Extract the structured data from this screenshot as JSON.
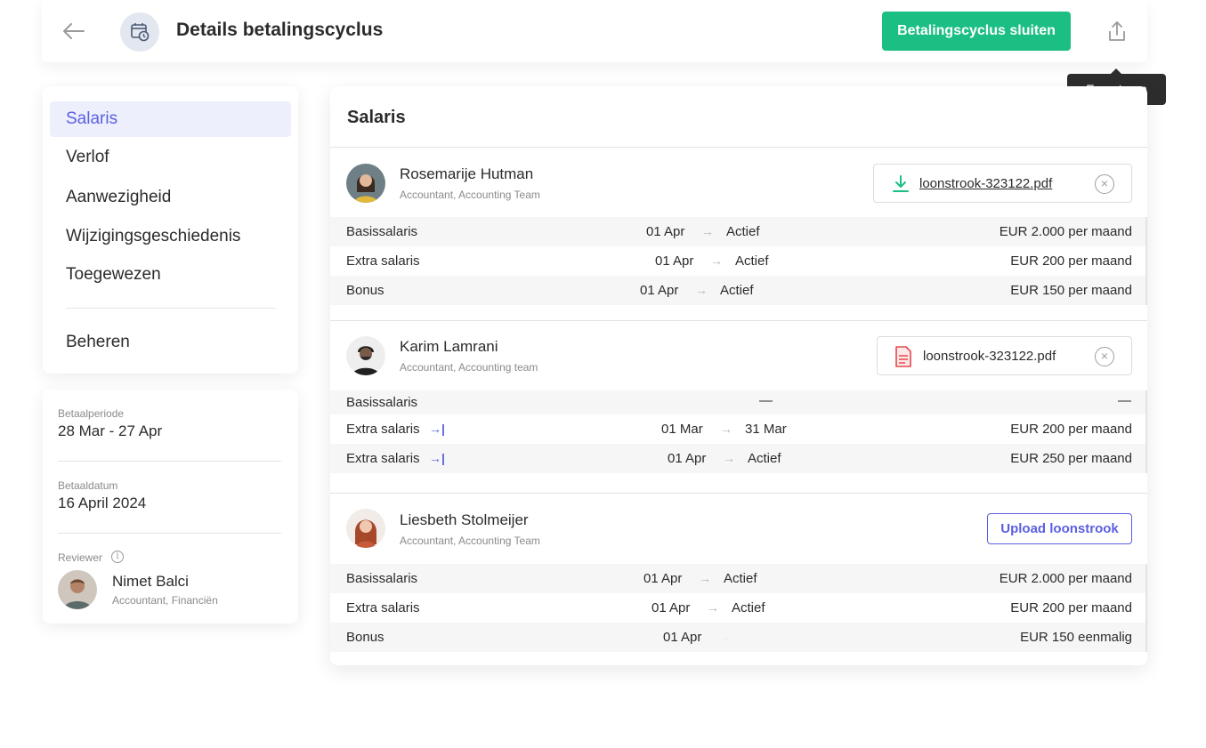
{
  "header": {
    "title": "Details betalingscyclus",
    "close_cycle_label": "Betalingscyclus sluiten",
    "export_tooltip": "Exporteren"
  },
  "sidebar": {
    "items": [
      {
        "label": "Salaris",
        "active": true
      },
      {
        "label": "Verlof"
      },
      {
        "label": "Aanwezigheid"
      },
      {
        "label": "Wijzigingsgeschiedenis"
      },
      {
        "label": "Toegewezen"
      }
    ],
    "manage_label": "Beheren"
  },
  "info": {
    "period_label": "Betaalperiode",
    "period_value": "28 Mar - 27 Apr",
    "paydate_label": "Betaaldatum",
    "paydate_value": "16 April 2024",
    "reviewer_label": "Reviewer",
    "reviewer_name": "Nimet Balci",
    "reviewer_role": "Accountant, Financiën"
  },
  "main": {
    "title": "Salaris",
    "employees": [
      {
        "name": "Rosemarije Hutman",
        "role": "Accountant, Accounting Team",
        "file": "loonstrook-323122.pdf",
        "rows": [
          {
            "label": "Basissalaris",
            "from": "01 Apr",
            "arrow": "→",
            "to": "Actief",
            "amount": "EUR 2.000 per maand"
          },
          {
            "label": "Extra salaris",
            "from": "01 Apr",
            "arrow": "→",
            "to": "Actief",
            "amount": "EUR 200 per maand"
          },
          {
            "label": "Bonus",
            "from": "01 Apr",
            "arrow": "→",
            "to": "Actief",
            "amount": "EUR 150 per maand"
          }
        ]
      },
      {
        "name": "Karim Lamrani",
        "role": "Accountant, Accounting team",
        "file": "loonstrook-323122.pdf",
        "rows": [
          {
            "label": "Basissalaris",
            "dash": "—",
            "amount_dash": "—"
          },
          {
            "label": "Extra salaris",
            "from": "01 Mar",
            "arrow": "→",
            "to": "31 Mar",
            "amount": "EUR 200 per maand"
          },
          {
            "label": "Extra salaris",
            "from": "01 Apr",
            "arrow": "→",
            "to": "Actief",
            "amount": "EUR 250 per maand"
          }
        ]
      },
      {
        "name": "Liesbeth Stolmeijer",
        "role": "Accountant, Accounting Team",
        "upload_label": "Upload loonstrook",
        "rows": [
          {
            "label": "Basissalaris",
            "from": "01 Apr",
            "arrow": "→",
            "to": "Actief",
            "amount": "EUR 2.000 per maand"
          },
          {
            "label": "Extra salaris",
            "from": "01 Apr",
            "arrow": "→",
            "to": "Actief",
            "amount": "EUR 200 per maand"
          },
          {
            "label": "Bonus",
            "from": "01 Apr",
            "arrow": "→",
            "amount": "EUR 150 eenmalig"
          }
        ]
      }
    ]
  },
  "colors": {
    "primary_green": "#1bbf83",
    "accent_purple": "#5a5fe0",
    "pdf_red": "#e5484d"
  },
  "icons": [
    "back-arrow-icon",
    "calendar-clock-icon",
    "share-export-icon",
    "download-icon",
    "pdf-file-icon",
    "remove-circle-icon",
    "start-marker-icon",
    "info-icon"
  ]
}
